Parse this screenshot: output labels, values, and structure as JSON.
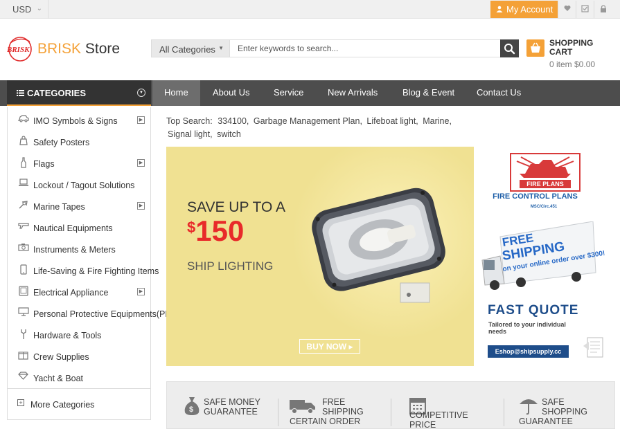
{
  "topbar": {
    "currency": "USD",
    "account_label": "My Account"
  },
  "header": {
    "logo_emblem_text": "BRISK",
    "brand_part1": "BRISK",
    "brand_part2": " Store",
    "search": {
      "category_label": "All Categories",
      "placeholder": "Enter keywords to search..."
    },
    "cart": {
      "title_line1": "SHOPPING",
      "title_line2": "CART",
      "summary": "0 item $0.00"
    }
  },
  "nav": {
    "categories_label": "CATEGORIES",
    "items": [
      "Home",
      "About Us",
      "Service",
      "New Arrivals",
      "Blog & Event",
      "Contact Us"
    ],
    "active_index": 0
  },
  "sidebar": {
    "items": [
      {
        "label": "IMO Symbols & Signs",
        "icon": "car-icon",
        "has_arrow": true
      },
      {
        "label": "Safety Posters",
        "icon": "bag-icon",
        "has_arrow": false
      },
      {
        "label": "Flags",
        "icon": "bottle-icon",
        "has_arrow": true
      },
      {
        "label": "Lockout / Tagout Solutions",
        "icon": "laptop-icon",
        "has_arrow": false
      },
      {
        "label": "Marine Tapes",
        "icon": "tape-icon",
        "has_arrow": true
      },
      {
        "label": "Nautical Equipments",
        "icon": "gun-icon",
        "has_arrow": false
      },
      {
        "label": "Instruments & Meters",
        "icon": "camera-icon",
        "has_arrow": false
      },
      {
        "label": "Life-Saving & Fire Fighting Items",
        "icon": "phone-icon",
        "has_arrow": false
      },
      {
        "label": "Electrical Appliance",
        "icon": "tablet-icon",
        "has_arrow": true
      },
      {
        "label": "Personal Protective Equipments(PPE)",
        "icon": "monitor-icon",
        "has_arrow": false
      },
      {
        "label": "Hardware & Tools",
        "icon": "wrench-icon",
        "has_arrow": false
      },
      {
        "label": "Crew Supplies",
        "icon": "gift-icon",
        "has_arrow": false
      },
      {
        "label": "Yacht & Boat",
        "icon": "diamond-icon",
        "has_arrow": false
      }
    ],
    "more_label": "More Categories"
  },
  "top_search": {
    "label": "Top Search:",
    "terms": [
      "334100,",
      "Garbage Management Plan,",
      "Lifeboat light,",
      "Marine,",
      "Signal light,",
      "switch"
    ]
  },
  "banner": {
    "line1": "SAVE UP TO A",
    "currency": "$",
    "amount": "150",
    "line3": "SHIP LIGHTING",
    "cta": "BUY NOW"
  },
  "side_ad": {
    "box_label": "FIRE PLANS",
    "title": "FIRE CONTROL PLANS",
    "circ": "MSC/Circ.451",
    "truck_line1": "FREE",
    "truck_line2": "SHIPPING",
    "truck_line3": "on your online order over $300!",
    "quote_title": "FAST QUOTE",
    "quote_sub": "Tailored to your individual needs",
    "email": "Eshop@shipsupply.cc"
  },
  "features": [
    {
      "line1": "SAFE MONEY",
      "line2": "GUARANTEE",
      "icon": "money-bag-icon"
    },
    {
      "line1": "FREE SHIPPING",
      "line2": "CERTAIN ORDER",
      "icon": "truck-icon"
    },
    {
      "line1": "COMPETITIVE",
      "line2": "PRICE",
      "icon": "calendar-icon"
    },
    {
      "line1": "SAFE SHOPPING",
      "line2": "GUARANTEE",
      "icon": "umbrella-icon"
    }
  ],
  "colors": {
    "accent": "#f4a137",
    "nav_bg": "#4d4d4d",
    "banner_bg": "#f0e192",
    "price_red": "#e82a2a",
    "ad_blue": "#1e4d8a"
  }
}
